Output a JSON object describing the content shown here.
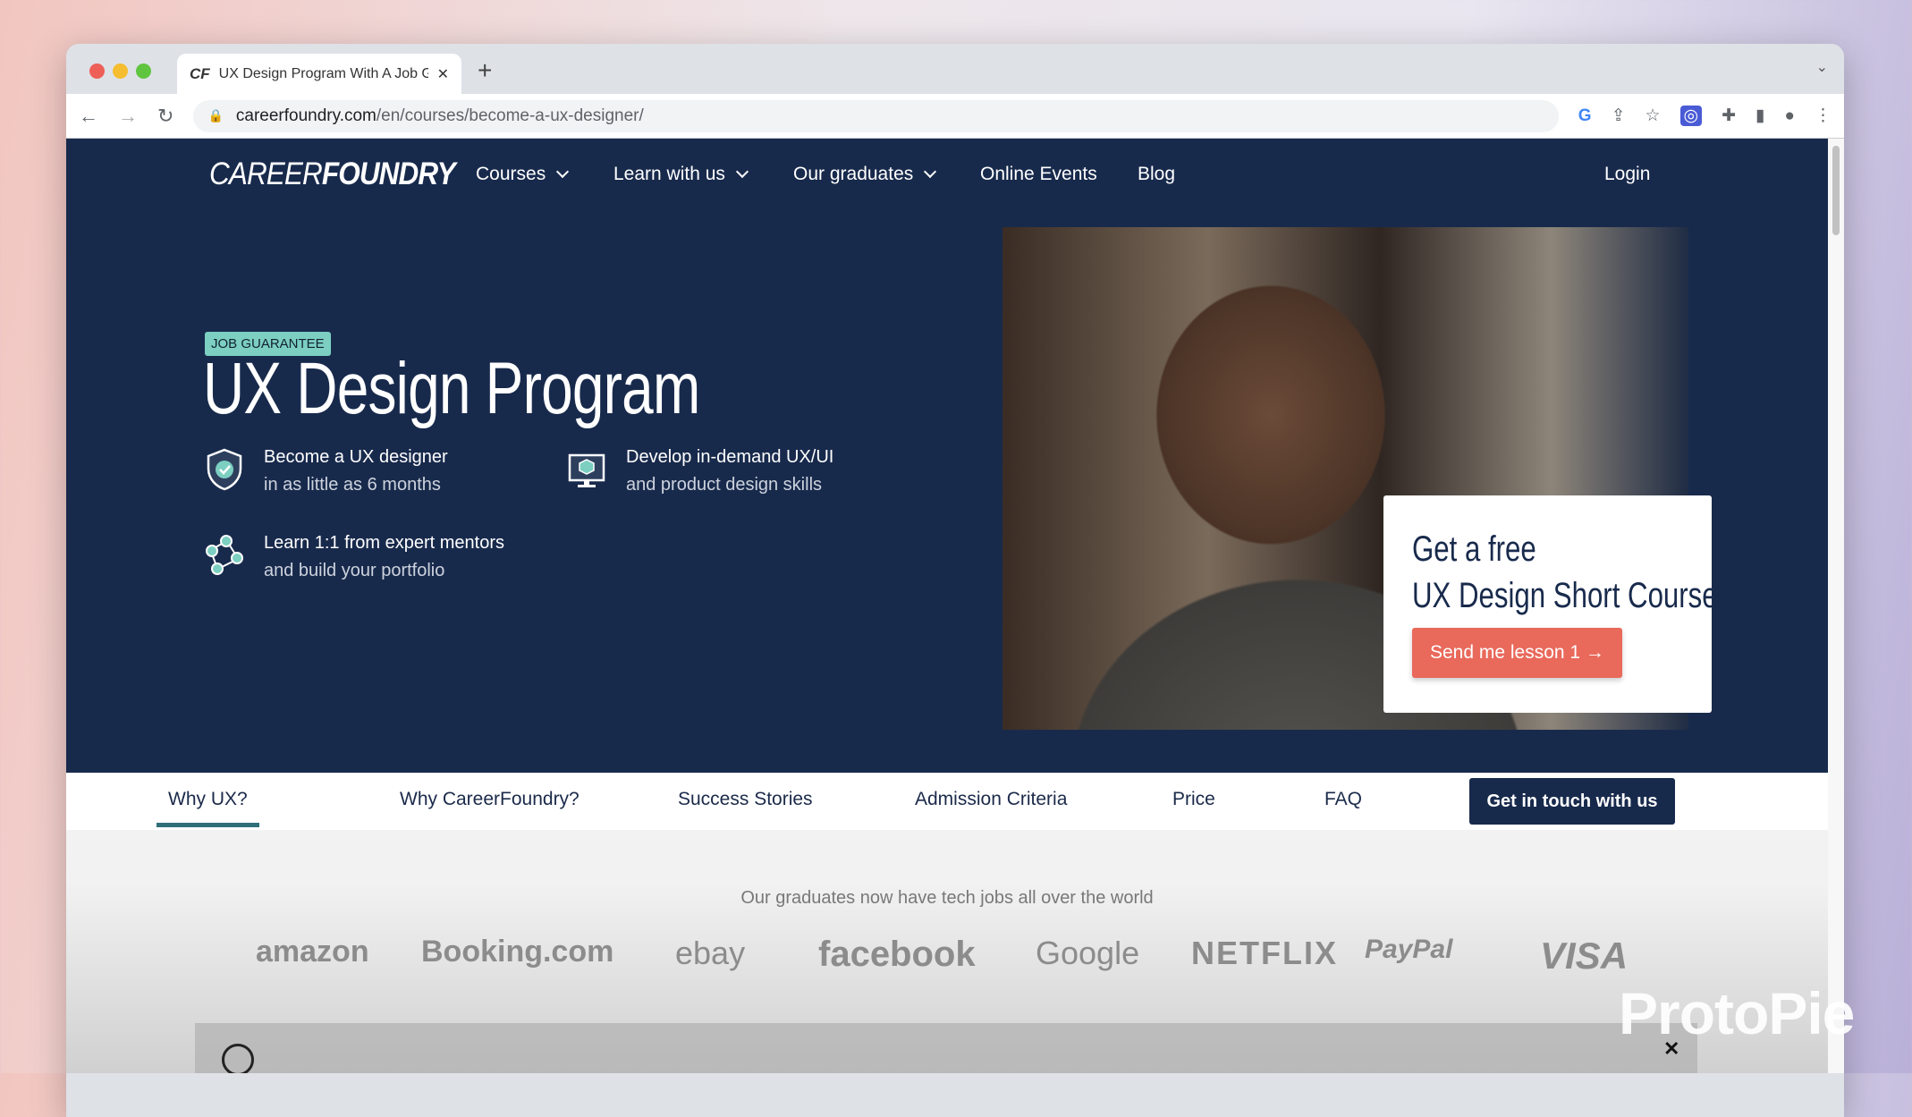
{
  "browser": {
    "tab_title": "UX Design Program With A Job Guarantee",
    "tab_favicon": "CF",
    "url_domain": "careerfoundry.com",
    "url_path": "/en/courses/become-a-ux-designer/"
  },
  "nav": {
    "logo_light": "CAREER",
    "logo_bold": "FOUNDRY",
    "items": [
      {
        "label": "Courses"
      },
      {
        "label": "Learn with us"
      },
      {
        "label": "Our graduates"
      },
      {
        "label": "Online Events"
      },
      {
        "label": "Blog"
      }
    ],
    "login": "Login"
  },
  "hero": {
    "badge": "JOB GUARANTEE",
    "title": "UX Design Program",
    "features": [
      {
        "icon": "shield-check-icon",
        "line1": "Become a UX designer",
        "line2": "in as little as 6 months"
      },
      {
        "icon": "monitor-cube-icon",
        "line1": "Develop in-demand UX/UI",
        "line2": "and product design skills"
      },
      {
        "icon": "mentors-network-icon",
        "line1": "Learn 1:1 from expert mentors",
        "line2": "and build your portfolio"
      }
    ],
    "card": {
      "line1": "Get a free",
      "line2": "UX Design Short Course",
      "button": "Send me lesson 1 →"
    }
  },
  "subnav": {
    "items": [
      "Why UX?",
      "Why CareerFoundry?",
      "Success Stories",
      "Admission Criteria",
      "Price",
      "FAQ"
    ],
    "cta": "Get in touch with us"
  },
  "graduates": {
    "tagline": "Our graduates now have tech jobs all over the world",
    "logos": [
      "amazon",
      "Booking.com",
      "ebay",
      "facebook",
      "Google",
      "NETFLIX",
      "PayPal",
      "VISA"
    ]
  },
  "watermark": "ProtoPie",
  "colors": {
    "navy": "#182a4c",
    "teal": "#7ccfc1",
    "coral": "#e9695b"
  }
}
